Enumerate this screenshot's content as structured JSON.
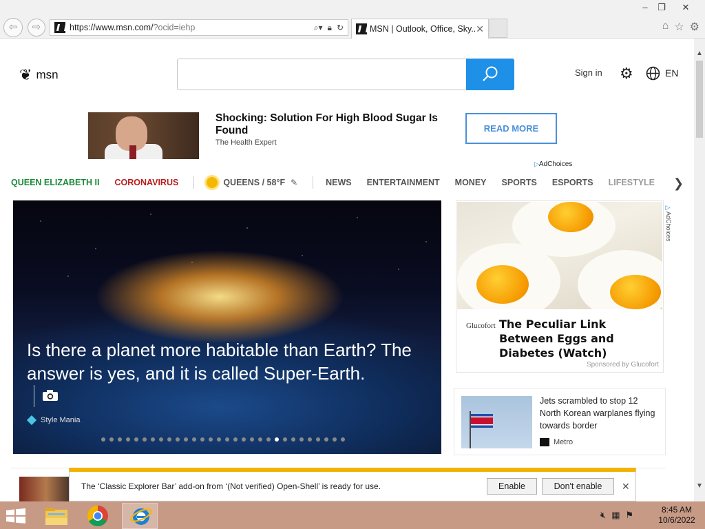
{
  "browser": {
    "url_host": "https://www.msn.com/",
    "url_path": "?ocid=iehp",
    "tab_title": "MSN | Outlook, Office, Sky...",
    "window_controls": [
      "minimize-icon",
      "restore-icon",
      "close-icon"
    ],
    "toolbar_icons": [
      "home-icon",
      "favorites-star-icon",
      "settings-gear-icon"
    ]
  },
  "header": {
    "logo_text": "msn",
    "search_placeholder": "",
    "sign_in": "Sign in",
    "language": "EN"
  },
  "ad_banner": {
    "headline": "Shocking: Solution For High Blood Sugar Is Found",
    "source": "The Health Expert",
    "cta": "READ MORE",
    "adchoices": "AdChoices"
  },
  "nav": {
    "items": [
      {
        "label": "QUEEN ELIZABETH II",
        "color": "#1a8a3a"
      },
      {
        "label": "CORONAVIRUS",
        "color": "#b71c1c"
      }
    ],
    "weather": "QUEENS / 58°F",
    "sections": [
      "NEWS",
      "ENTERTAINMENT",
      "MONEY",
      "SPORTS",
      "ESPORTS",
      "LIFESTYLE"
    ]
  },
  "hero": {
    "title": "Is there a planet more habitable than Earth? The answer is yes, and it is called Super-Earth.",
    "source": "Style Mania",
    "slide_count": 30,
    "active_slide": 21
  },
  "sponsored_card": {
    "brand": "Glucofort",
    "headline": "The Peculiar Link Between Eggs and Diabetes (Watch)",
    "sponsored": "Sponsored by Glucofort",
    "adchoices": "AdChoices"
  },
  "news_card": {
    "title": "Jets scrambled to stop 12 North Korean warplanes flying towards border",
    "source": "Metro"
  },
  "notification": {
    "message": "The ‘Classic Explorer Bar’ add-on from ‘(Not verified) Open-Shell’ is ready for use.",
    "enable": "Enable",
    "dont_enable": "Don't enable"
  },
  "taskbar": {
    "apps": [
      "file-explorer-icon",
      "chrome-icon",
      "internet-explorer-icon"
    ],
    "time": "8:45 AM",
    "date": "10/6/2022",
    "colors": {
      "taskbar": "#c79a86",
      "accent": "#1e90e8",
      "notification": "#f2b300"
    }
  }
}
